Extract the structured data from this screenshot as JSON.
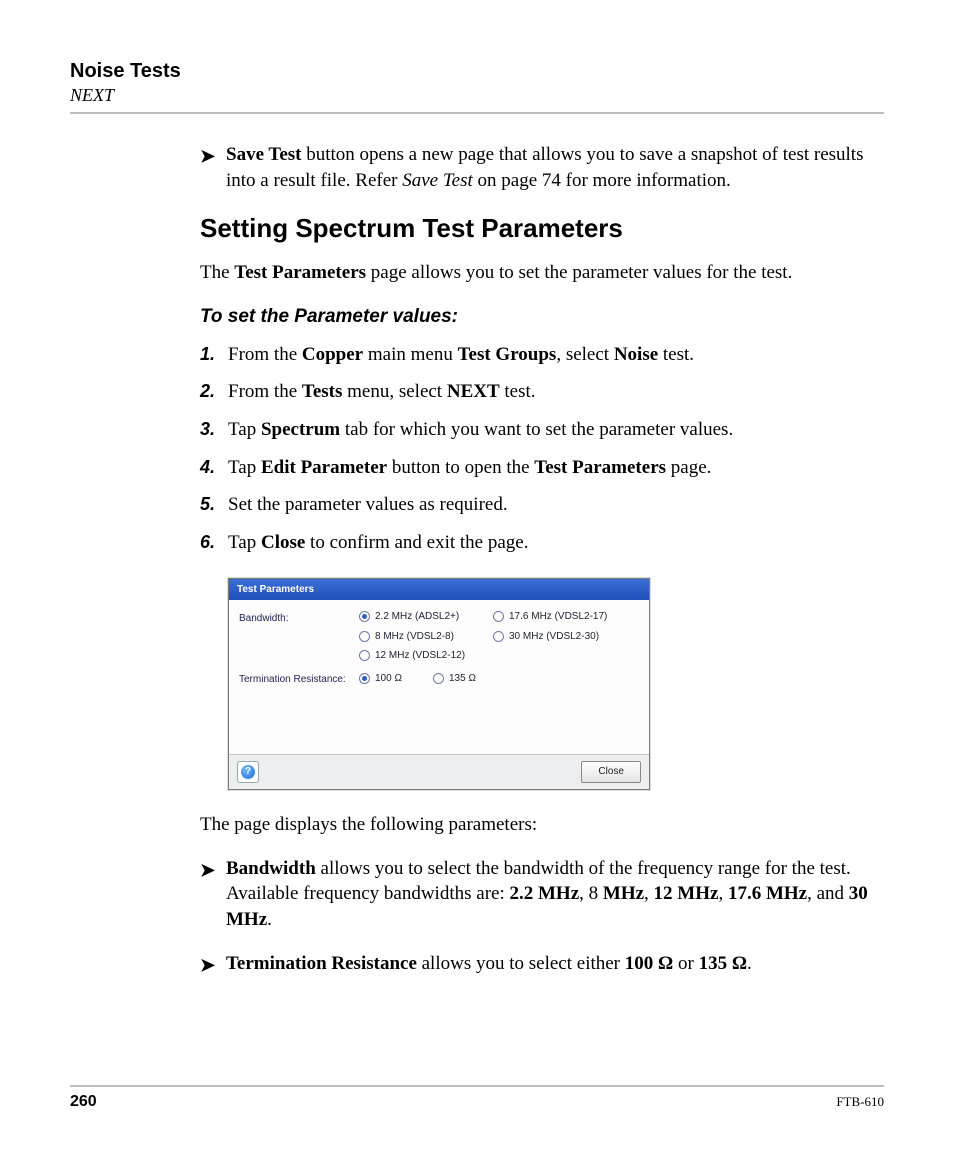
{
  "header": {
    "title": "Noise Tests",
    "subtitle": "NEXT"
  },
  "intro_bullet": {
    "bold": "Save Test",
    "rest": " button opens a new page that allows you to save a snapshot of test results into a result file. Refer ",
    "italic": "Save Test",
    "rest2": " on page 74 for more information."
  },
  "section": {
    "heading": "Setting Spectrum Test Parameters",
    "lead_pre": "The ",
    "lead_bold": "Test Parameters",
    "lead_post": " page allows you to set the parameter values for the test.",
    "subhead": "To set the Parameter values:",
    "steps": [
      {
        "n": "1.",
        "parts": [
          {
            "t": "From the "
          },
          {
            "b": "Copper"
          },
          {
            "t": " main menu "
          },
          {
            "b": "Test Groups"
          },
          {
            "t": ", select "
          },
          {
            "b": "Noise"
          },
          {
            "t": " test."
          }
        ]
      },
      {
        "n": "2.",
        "parts": [
          {
            "t": "From the "
          },
          {
            "b": "Tests"
          },
          {
            "t": " menu, select "
          },
          {
            "b": "NEXT"
          },
          {
            "t": " test."
          }
        ]
      },
      {
        "n": "3.",
        "parts": [
          {
            "t": "Tap "
          },
          {
            "b": "Spectrum"
          },
          {
            "t": " tab for which you want to set the parameter values."
          }
        ]
      },
      {
        "n": "4.",
        "parts": [
          {
            "t": "Tap "
          },
          {
            "b": "Edit Parameter"
          },
          {
            "t": " button to open the "
          },
          {
            "b": "Test Parameters"
          },
          {
            "t": " page."
          }
        ]
      },
      {
        "n": "5.",
        "parts": [
          {
            "t": "Set the parameter values as required."
          }
        ]
      },
      {
        "n": "6.",
        "parts": [
          {
            "t": "Tap "
          },
          {
            "b": "Close"
          },
          {
            "t": " to confirm and exit the page."
          }
        ]
      }
    ]
  },
  "dialog": {
    "title": "Test Parameters",
    "rows": [
      {
        "label": "Bandwidth:",
        "options": [
          {
            "label": "2.2 MHz (ADSL2+)",
            "selected": true
          },
          {
            "label": "17.6 MHz (VDSL2-17)",
            "selected": false
          },
          {
            "label": "8 MHz (VDSL2-8)",
            "selected": false
          },
          {
            "label": "30 MHz (VDSL2-30)",
            "selected": false
          },
          {
            "label": "12 MHz (VDSL2-12)",
            "selected": false
          }
        ]
      },
      {
        "label": "Termination Resistance:",
        "options": [
          {
            "label": "100 Ω",
            "selected": true
          },
          {
            "label": "135 Ω",
            "selected": false
          }
        ]
      }
    ],
    "close": "Close",
    "help": "?"
  },
  "after_dialog": "The page displays the following parameters:",
  "param_bullets": [
    {
      "parts": [
        {
          "b": "Bandwidth"
        },
        {
          "t": " allows you to select the bandwidth of the frequency range for the test. Available frequency bandwidths are: "
        },
        {
          "b": "2.2 MHz"
        },
        {
          "t": ", 8 "
        },
        {
          "b": "MHz"
        },
        {
          "t": ", "
        },
        {
          "b": "12 MHz"
        },
        {
          "t": ", "
        },
        {
          "b": "17.6 MHz"
        },
        {
          "t": ", and "
        },
        {
          "b": "30 MHz"
        },
        {
          "t": "."
        }
      ]
    },
    {
      "parts": [
        {
          "b": "Termination Resistance"
        },
        {
          "t": " allows you to select either "
        },
        {
          "b": "100 Ω"
        },
        {
          "t": " or "
        },
        {
          "b": "135 Ω"
        },
        {
          "t": "."
        }
      ]
    }
  ],
  "footer": {
    "page": "260",
    "docid": "FTB-610"
  }
}
